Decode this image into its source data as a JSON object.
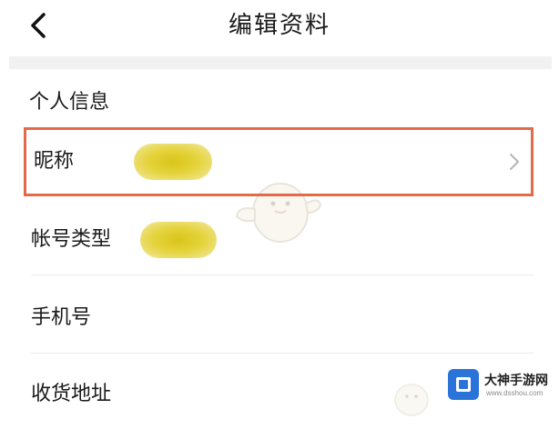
{
  "header": {
    "title": "编辑资料",
    "back_icon": "chevron-left-icon"
  },
  "section": {
    "title": "个人信息"
  },
  "rows": [
    {
      "label": "昵称",
      "value_redacted": true,
      "chevron_icon": "chevron-right-icon",
      "highlighted": true
    },
    {
      "label": "帐号类型",
      "value_redacted": true
    },
    {
      "label": "手机号"
    },
    {
      "label": "收货地址"
    }
  ],
  "colors": {
    "highlight_border": "#e26a47",
    "redaction": "#e4d33a",
    "brand_blue": "#2a73d9"
  },
  "watermark": {
    "brand_name": "大神手游网",
    "site": "www.dsshou.com"
  }
}
